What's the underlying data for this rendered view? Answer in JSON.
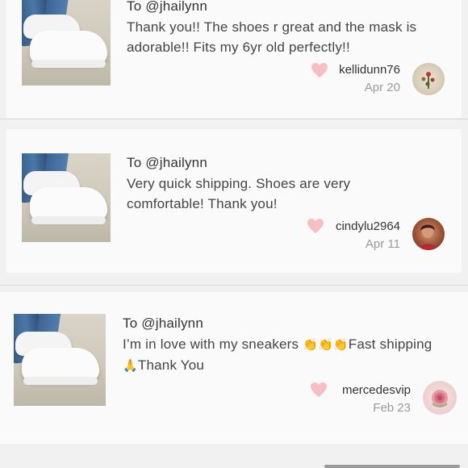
{
  "reviews": [
    {
      "to": "To @jhailynn",
      "message": "Thank you!! The shoes r great and the mask is adorable!! Fits my 6yr old perfectly!!",
      "username": "kellidunn76",
      "date": "Apr 20"
    },
    {
      "to": "To @jhailynn",
      "message": "Very quick shipping. Shoes are very comfortable! Thank you!",
      "username": "cindylu2964",
      "date": "Apr 11"
    },
    {
      "to": "To @jhailynn",
      "message_part1": "I’m in love with my sneakers ",
      "message_clap": "👏👏👏",
      "message_part2": "Fast shipping ",
      "message_pray": "🙏",
      "message_part3": "Thank You",
      "username": "mercedesvip",
      "date": "Feb 23"
    }
  ],
  "icons": {
    "heart": "heart-icon",
    "heart_color": "#f6bfc4"
  }
}
